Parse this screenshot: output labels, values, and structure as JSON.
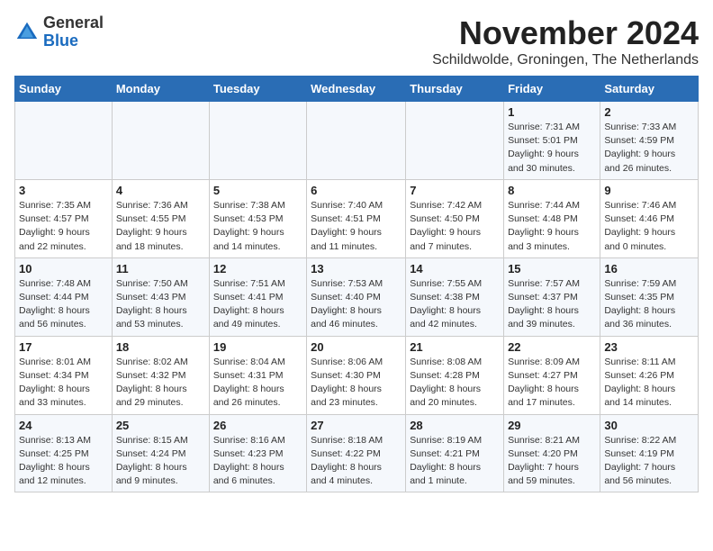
{
  "logo": {
    "general": "General",
    "blue": "Blue"
  },
  "title": "November 2024",
  "subtitle": "Schildwolde, Groningen, The Netherlands",
  "days_of_week": [
    "Sunday",
    "Monday",
    "Tuesday",
    "Wednesday",
    "Thursday",
    "Friday",
    "Saturday"
  ],
  "weeks": [
    [
      {
        "day": "",
        "detail": ""
      },
      {
        "day": "",
        "detail": ""
      },
      {
        "day": "",
        "detail": ""
      },
      {
        "day": "",
        "detail": ""
      },
      {
        "day": "",
        "detail": ""
      },
      {
        "day": "1",
        "detail": "Sunrise: 7:31 AM\nSunset: 5:01 PM\nDaylight: 9 hours\nand 30 minutes."
      },
      {
        "day": "2",
        "detail": "Sunrise: 7:33 AM\nSunset: 4:59 PM\nDaylight: 9 hours\nand 26 minutes."
      }
    ],
    [
      {
        "day": "3",
        "detail": "Sunrise: 7:35 AM\nSunset: 4:57 PM\nDaylight: 9 hours\nand 22 minutes."
      },
      {
        "day": "4",
        "detail": "Sunrise: 7:36 AM\nSunset: 4:55 PM\nDaylight: 9 hours\nand 18 minutes."
      },
      {
        "day": "5",
        "detail": "Sunrise: 7:38 AM\nSunset: 4:53 PM\nDaylight: 9 hours\nand 14 minutes."
      },
      {
        "day": "6",
        "detail": "Sunrise: 7:40 AM\nSunset: 4:51 PM\nDaylight: 9 hours\nand 11 minutes."
      },
      {
        "day": "7",
        "detail": "Sunrise: 7:42 AM\nSunset: 4:50 PM\nDaylight: 9 hours\nand 7 minutes."
      },
      {
        "day": "8",
        "detail": "Sunrise: 7:44 AM\nSunset: 4:48 PM\nDaylight: 9 hours\nand 3 minutes."
      },
      {
        "day": "9",
        "detail": "Sunrise: 7:46 AM\nSunset: 4:46 PM\nDaylight: 9 hours\nand 0 minutes."
      }
    ],
    [
      {
        "day": "10",
        "detail": "Sunrise: 7:48 AM\nSunset: 4:44 PM\nDaylight: 8 hours\nand 56 minutes."
      },
      {
        "day": "11",
        "detail": "Sunrise: 7:50 AM\nSunset: 4:43 PM\nDaylight: 8 hours\nand 53 minutes."
      },
      {
        "day": "12",
        "detail": "Sunrise: 7:51 AM\nSunset: 4:41 PM\nDaylight: 8 hours\nand 49 minutes."
      },
      {
        "day": "13",
        "detail": "Sunrise: 7:53 AM\nSunset: 4:40 PM\nDaylight: 8 hours\nand 46 minutes."
      },
      {
        "day": "14",
        "detail": "Sunrise: 7:55 AM\nSunset: 4:38 PM\nDaylight: 8 hours\nand 42 minutes."
      },
      {
        "day": "15",
        "detail": "Sunrise: 7:57 AM\nSunset: 4:37 PM\nDaylight: 8 hours\nand 39 minutes."
      },
      {
        "day": "16",
        "detail": "Sunrise: 7:59 AM\nSunset: 4:35 PM\nDaylight: 8 hours\nand 36 minutes."
      }
    ],
    [
      {
        "day": "17",
        "detail": "Sunrise: 8:01 AM\nSunset: 4:34 PM\nDaylight: 8 hours\nand 33 minutes."
      },
      {
        "day": "18",
        "detail": "Sunrise: 8:02 AM\nSunset: 4:32 PM\nDaylight: 8 hours\nand 29 minutes."
      },
      {
        "day": "19",
        "detail": "Sunrise: 8:04 AM\nSunset: 4:31 PM\nDaylight: 8 hours\nand 26 minutes."
      },
      {
        "day": "20",
        "detail": "Sunrise: 8:06 AM\nSunset: 4:30 PM\nDaylight: 8 hours\nand 23 minutes."
      },
      {
        "day": "21",
        "detail": "Sunrise: 8:08 AM\nSunset: 4:28 PM\nDaylight: 8 hours\nand 20 minutes."
      },
      {
        "day": "22",
        "detail": "Sunrise: 8:09 AM\nSunset: 4:27 PM\nDaylight: 8 hours\nand 17 minutes."
      },
      {
        "day": "23",
        "detail": "Sunrise: 8:11 AM\nSunset: 4:26 PM\nDaylight: 8 hours\nand 14 minutes."
      }
    ],
    [
      {
        "day": "24",
        "detail": "Sunrise: 8:13 AM\nSunset: 4:25 PM\nDaylight: 8 hours\nand 12 minutes."
      },
      {
        "day": "25",
        "detail": "Sunrise: 8:15 AM\nSunset: 4:24 PM\nDaylight: 8 hours\nand 9 minutes."
      },
      {
        "day": "26",
        "detail": "Sunrise: 8:16 AM\nSunset: 4:23 PM\nDaylight: 8 hours\nand 6 minutes."
      },
      {
        "day": "27",
        "detail": "Sunrise: 8:18 AM\nSunset: 4:22 PM\nDaylight: 8 hours\nand 4 minutes."
      },
      {
        "day": "28",
        "detail": "Sunrise: 8:19 AM\nSunset: 4:21 PM\nDaylight: 8 hours\nand 1 minute."
      },
      {
        "day": "29",
        "detail": "Sunrise: 8:21 AM\nSunset: 4:20 PM\nDaylight: 7 hours\nand 59 minutes."
      },
      {
        "day": "30",
        "detail": "Sunrise: 8:22 AM\nSunset: 4:19 PM\nDaylight: 7 hours\nand 56 minutes."
      }
    ]
  ]
}
